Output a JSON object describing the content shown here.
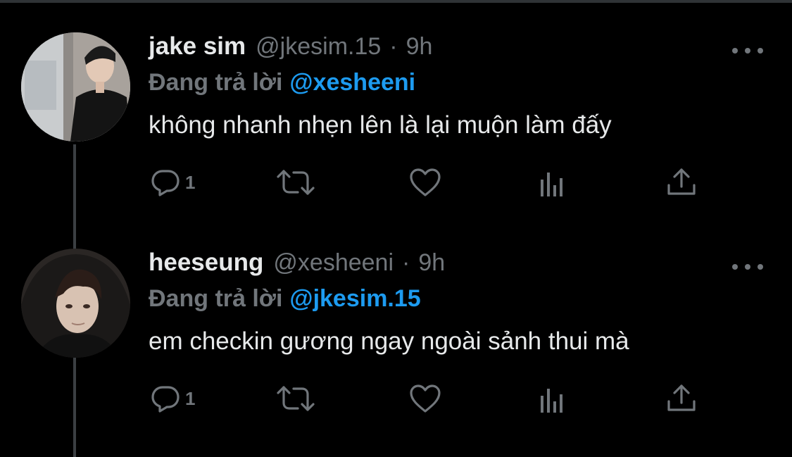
{
  "colors": {
    "background": "#000000",
    "primary_text": "#e7e9ea",
    "secondary_text": "#71767b",
    "mention": "#1d9bf0",
    "thread_line": "#3b3f43"
  },
  "tweets": [
    {
      "name": "jake sim",
      "handle": "@jkesim.15",
      "dot": "·",
      "time": "9h",
      "reply_prefix": "Đang trả lời",
      "reply_to": "@xesheeni",
      "text": "không nhanh nhẹn lên là lại muộn làm đấy",
      "reply_count": "1",
      "icons": [
        "reply-icon",
        "retweet-icon",
        "like-icon",
        "analytics-icon",
        "share-icon",
        "more-icon"
      ]
    },
    {
      "name": "heeseung",
      "handle": "@xesheeni",
      "dot": "·",
      "time": "9h",
      "reply_prefix": "Đang trả lời",
      "reply_to": "@jkesim.15",
      "text": "em checkin gương ngay ngoài sảnh thui mà",
      "reply_count": "1",
      "icons": [
        "reply-icon",
        "retweet-icon",
        "like-icon",
        "analytics-icon",
        "share-icon",
        "more-icon"
      ]
    }
  ]
}
